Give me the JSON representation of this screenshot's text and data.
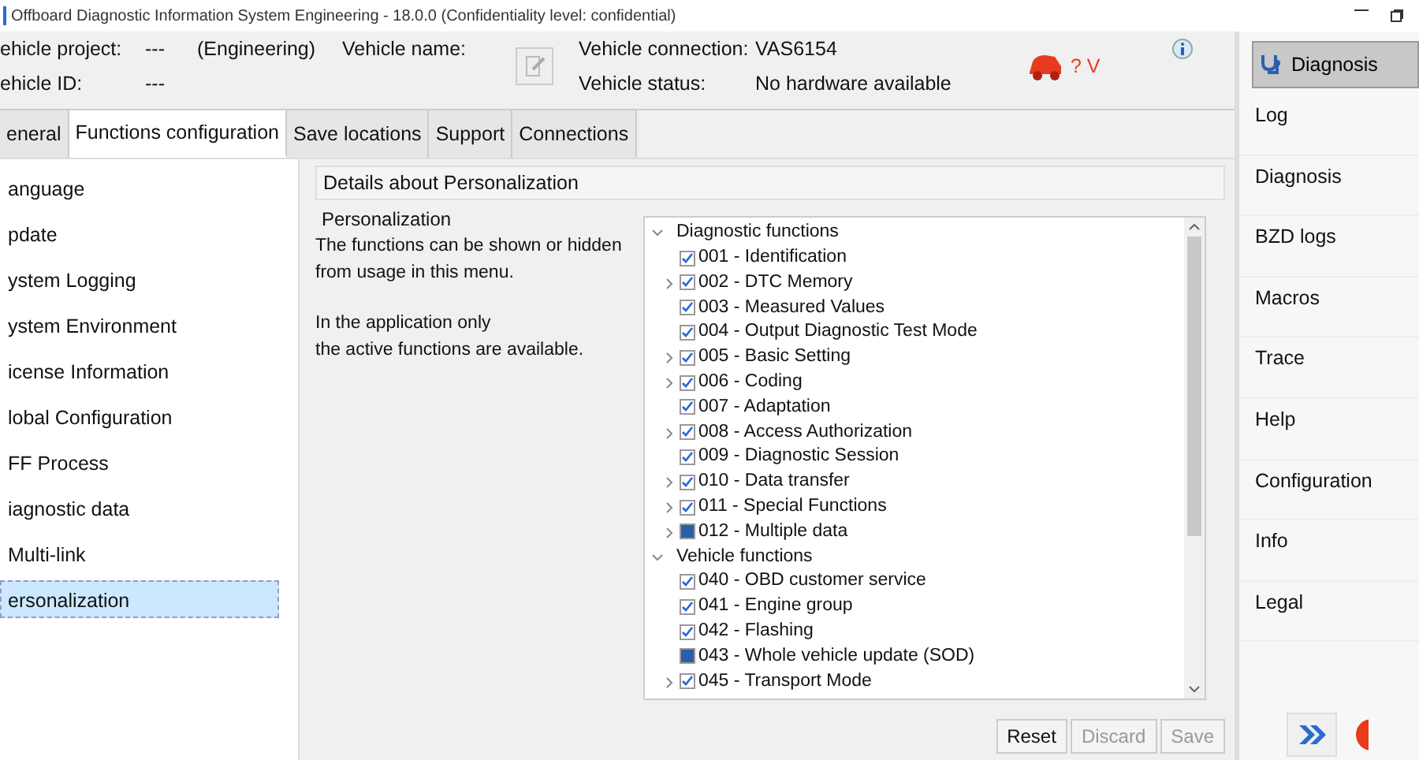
{
  "window": {
    "title": "Offboard Diagnostic Information System Engineering - 18.0.0 (Confidentiality level: confidential)"
  },
  "header": {
    "project_label": "ehicle project:",
    "project_value": "---",
    "project_mode": "(Engineering)",
    "name_label": "Vehicle name:",
    "id_label": "ehicle ID:",
    "id_value": "---",
    "connection_label": "Vehicle connection:",
    "connection_value": "VAS6154",
    "status_label": "Vehicle status:",
    "status_value": "No hardware available",
    "voltage": "? V"
  },
  "tabs": [
    {
      "label": "eneral",
      "selected": false
    },
    {
      "label": "Functions configuration",
      "selected": true
    },
    {
      "label": "Save locations",
      "selected": false
    },
    {
      "label": "Support",
      "selected": false
    },
    {
      "label": "Connections",
      "selected": false
    }
  ],
  "sidebar": {
    "items": [
      {
        "label": "anguage",
        "selected": false
      },
      {
        "label": "pdate",
        "selected": false
      },
      {
        "label": "ystem Logging",
        "selected": false
      },
      {
        "label": "ystem Environment",
        "selected": false
      },
      {
        "label": "icense Information",
        "selected": false
      },
      {
        "label": "lobal Configuration",
        "selected": false
      },
      {
        "label": "FF Process",
        "selected": false
      },
      {
        "label": "iagnostic data",
        "selected": false
      },
      {
        "label": "Multi-link",
        "selected": false
      },
      {
        "label": "ersonalization",
        "selected": true
      }
    ]
  },
  "details": {
    "title": "Details about Personalization",
    "section": "Personalization",
    "text1": "The functions can be shown or hidden from usage in this menu.",
    "text2": "In the application only",
    "text3": "the active functions are available.",
    "tree": [
      {
        "label": "Diagnostic functions",
        "expanded": true,
        "children": [
          {
            "label": "001 - Identification",
            "checked": true,
            "partial": false,
            "has_children": false
          },
          {
            "label": "002 - DTC Memory",
            "checked": true,
            "partial": false,
            "has_children": true
          },
          {
            "label": "003 - Measured Values",
            "checked": true,
            "partial": false,
            "has_children": false
          },
          {
            "label": "004 - Output Diagnostic Test Mode",
            "checked": true,
            "partial": false,
            "has_children": false
          },
          {
            "label": "005 - Basic Setting",
            "checked": true,
            "partial": false,
            "has_children": true
          },
          {
            "label": "006 - Coding",
            "checked": true,
            "partial": false,
            "has_children": true
          },
          {
            "label": "007 - Adaptation",
            "checked": true,
            "partial": false,
            "has_children": false
          },
          {
            "label": "008 - Access Authorization",
            "checked": true,
            "partial": false,
            "has_children": true
          },
          {
            "label": "009 - Diagnostic Session",
            "checked": true,
            "partial": false,
            "has_children": false
          },
          {
            "label": "010 - Data transfer",
            "checked": true,
            "partial": false,
            "has_children": true
          },
          {
            "label": "011 - Special Functions",
            "checked": true,
            "partial": false,
            "has_children": true
          },
          {
            "label": "012 - Multiple data",
            "checked": false,
            "partial": true,
            "has_children": true
          }
        ]
      },
      {
        "label": "Vehicle functions",
        "expanded": true,
        "children": [
          {
            "label": "040 - OBD customer service",
            "checked": true,
            "partial": false,
            "has_children": false
          },
          {
            "label": "041 - Engine group",
            "checked": true,
            "partial": false,
            "has_children": false
          },
          {
            "label": "042 - Flashing",
            "checked": true,
            "partial": false,
            "has_children": false
          },
          {
            "label": "043 - Whole vehicle update (SOD)",
            "checked": false,
            "partial": true,
            "has_children": false
          },
          {
            "label": "045 - Transport Mode",
            "checked": true,
            "partial": false,
            "has_children": true
          }
        ]
      }
    ]
  },
  "buttons": [
    {
      "label": "Reset",
      "disabled": false
    },
    {
      "label": "Discard",
      "disabled": true
    },
    {
      "label": "Save",
      "disabled": true
    }
  ],
  "right_panel": {
    "mode_button": "Diagnosis",
    "items": [
      {
        "label": "Log"
      },
      {
        "label": "Diagnosis"
      },
      {
        "label": "BZD logs"
      },
      {
        "label": "Macros"
      },
      {
        "label": "Trace"
      },
      {
        "label": "Help"
      },
      {
        "label": "Configuration"
      },
      {
        "label": "Info"
      },
      {
        "label": "Legal"
      }
    ]
  }
}
